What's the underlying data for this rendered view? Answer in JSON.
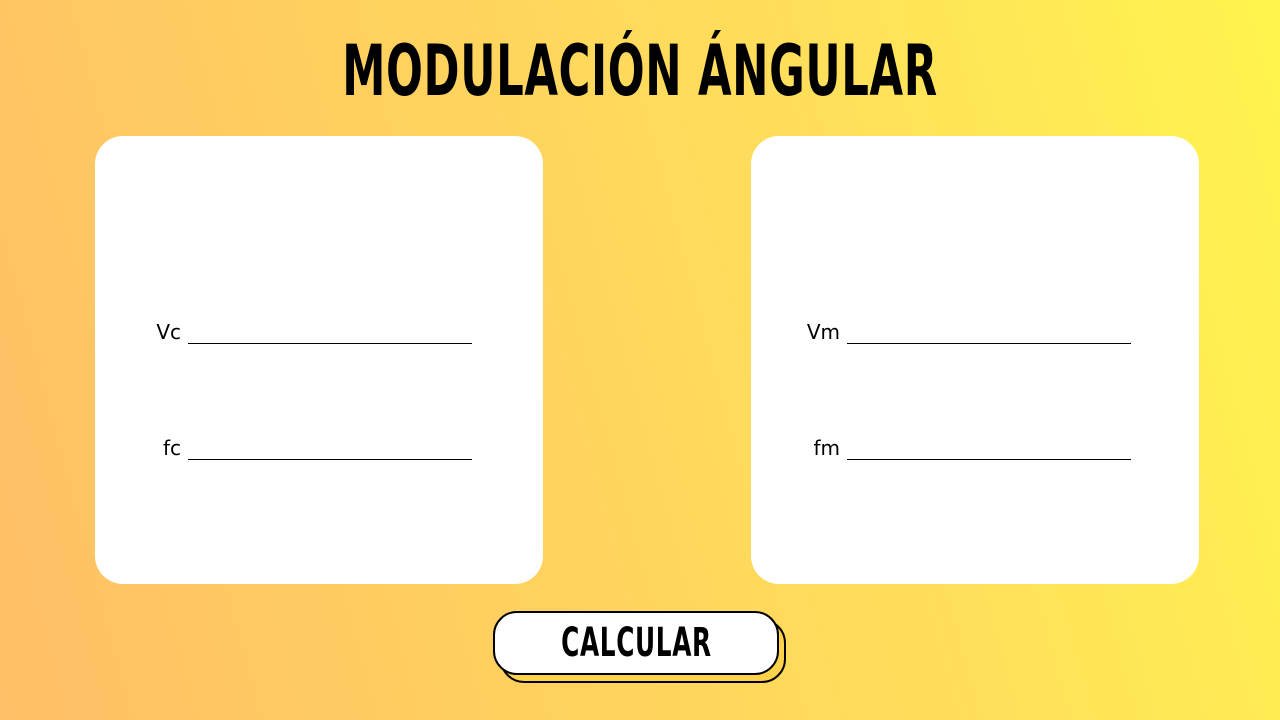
{
  "title": "MODULACIÓN ÁNGULAR",
  "carrier_card": {
    "fields": [
      {
        "label": "Vc",
        "value": ""
      },
      {
        "label": "fc",
        "value": ""
      }
    ]
  },
  "modulating_card": {
    "fields": [
      {
        "label": "Vm",
        "value": ""
      },
      {
        "label": "fm",
        "value": ""
      }
    ]
  },
  "button": {
    "label": "CALCULAR"
  },
  "colors": {
    "gradient_start": "#ffbf66",
    "gradient_end": "#fff44d",
    "card": "#ffffff",
    "button_shadow": "#ffd24a",
    "text": "#000000"
  }
}
